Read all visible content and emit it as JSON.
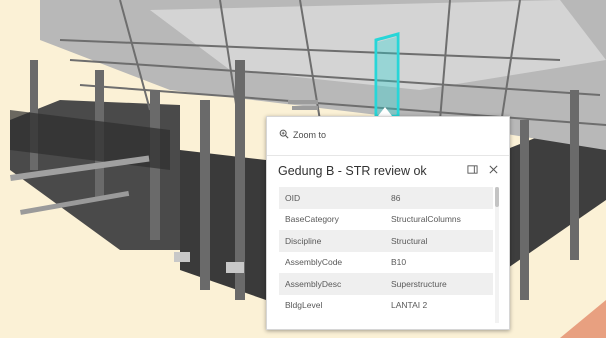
{
  "popup": {
    "zoom_label": "Zoom to",
    "title": "Gedung B - STR review ok",
    "dock_icon": "dock-icon",
    "close_icon": "close-icon",
    "zoom_icon": "magnifier-plus-icon",
    "attributes": [
      {
        "key": "OID",
        "value": "86"
      },
      {
        "key": "BaseCategory",
        "value": "StructuralColumns"
      },
      {
        "key": "Discipline",
        "value": "Structural"
      },
      {
        "key": "AssemblyCode",
        "value": "B10"
      },
      {
        "key": "AssemblyDesc",
        "value": "Superstructure"
      },
      {
        "key": "BldgLevel",
        "value": "LANTAI 2"
      }
    ]
  },
  "colors": {
    "ground": "#fbf1d6",
    "selection_highlight": "#27d6d8",
    "building_dark": "#3d3d3d",
    "building_mid": "#8c8c8c",
    "building_light": "#cfcfcf",
    "terrain_edge": "#e8a080"
  }
}
